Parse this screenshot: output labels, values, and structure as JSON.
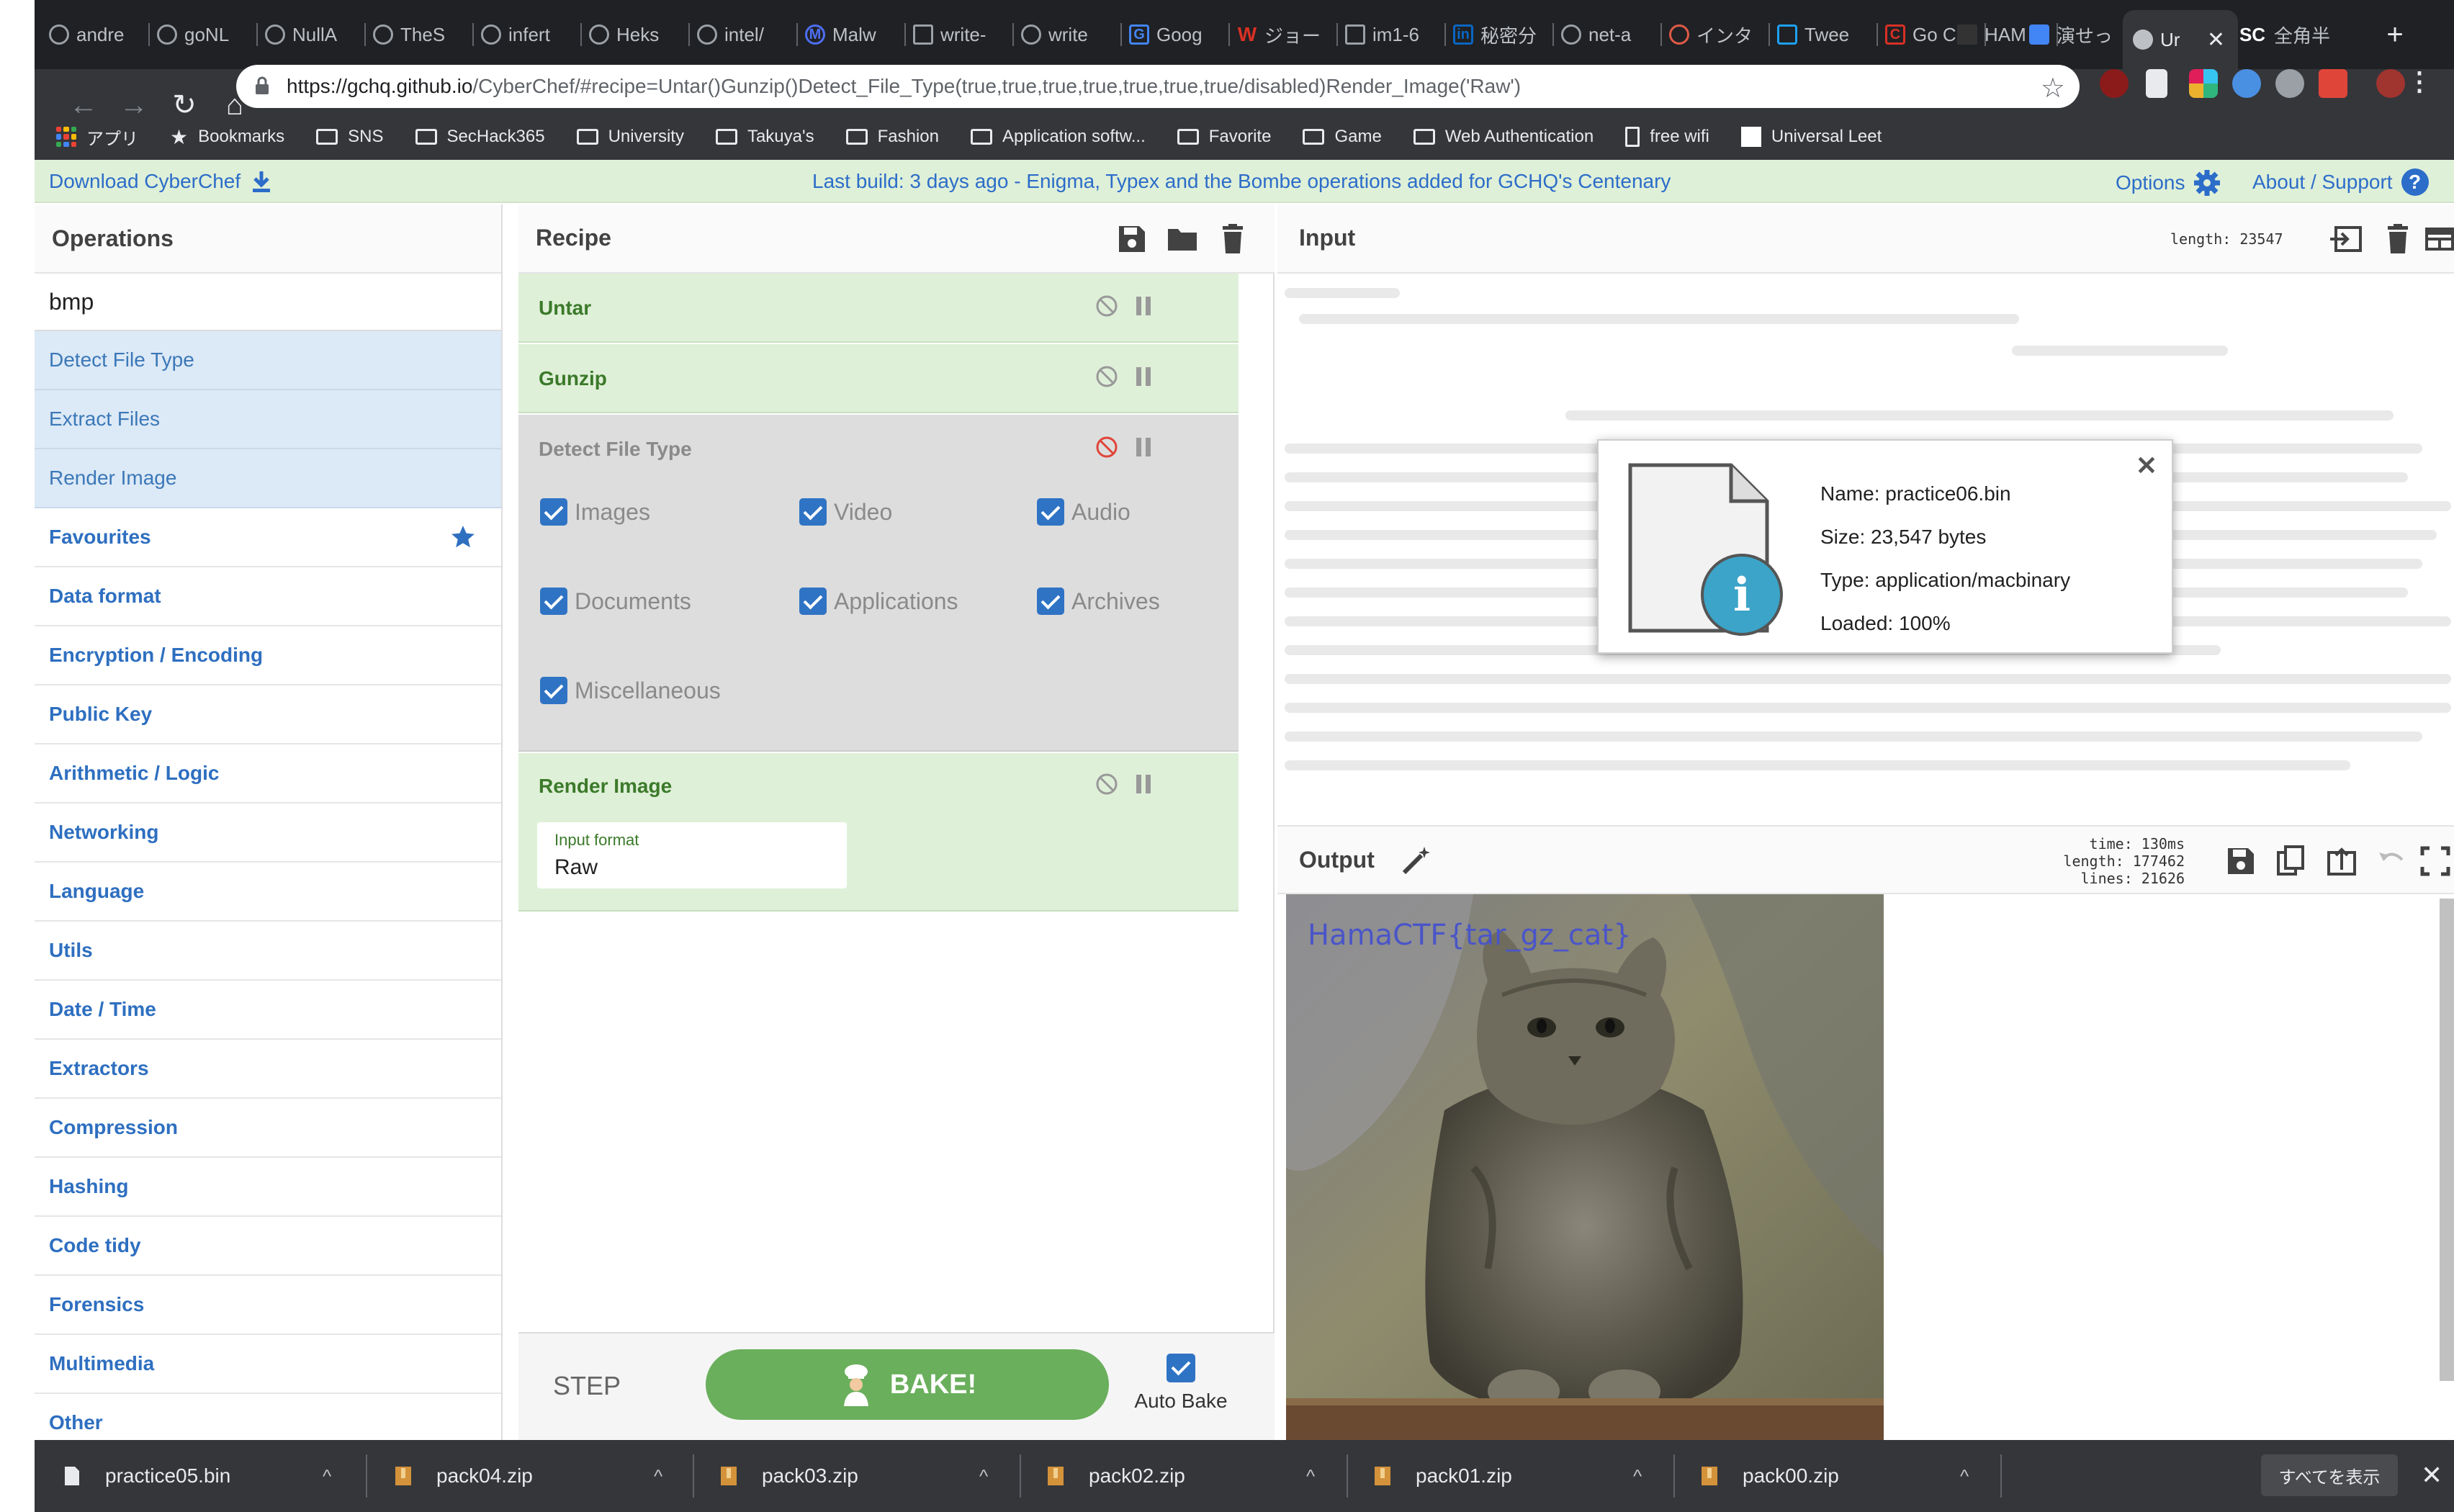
{
  "browser": {
    "tabs": [
      {
        "label": "andre"
      },
      {
        "label": "goNL"
      },
      {
        "label": "NullA"
      },
      {
        "label": "TheS"
      },
      {
        "label": "infert"
      },
      {
        "label": "Heks"
      },
      {
        "label": "intel/"
      },
      {
        "label": "Malw"
      },
      {
        "label": "write-"
      },
      {
        "label": "write"
      },
      {
        "label": "Goog"
      },
      {
        "label": "ジョー"
      },
      {
        "label": "im1-6"
      },
      {
        "label": "秘密分"
      },
      {
        "label": "net-a"
      },
      {
        "label": "インタ"
      },
      {
        "label": "Twee"
      },
      {
        "label": "Go C"
      },
      {
        "label": "HAM"
      },
      {
        "label": "演せっ"
      },
      {
        "label": "Ur"
      },
      {
        "label": "全角半"
      }
    ],
    "url": {
      "host": "https://gchq.github.io",
      "rest": "/CyberChef/#recipe=Untar()Gunzip()Detect_File_Type(true,true,true,true,true,true,true/disabled)Render_Image('Raw')"
    },
    "bookmarks": [
      "アプリ",
      "Bookmarks",
      "SNS",
      "SecHack365",
      "University",
      "Takuya's",
      "Fashion",
      "Application softw...",
      "Favorite",
      "Game",
      "Web Authentication",
      "free wifi",
      "Universal Leet"
    ]
  },
  "banner": {
    "download": "Download CyberChef",
    "build": "Last build: 3 days ago - Enigma, Typex and the Bombe operations added for GCHQ's Centenary",
    "options": "Options",
    "about": "About / Support"
  },
  "operations": {
    "title": "Operations",
    "search": "bmp",
    "results": [
      "Detect File Type",
      "Extract Files",
      "Render Image"
    ],
    "categories": [
      "Favourites",
      "Data format",
      "Encryption / Encoding",
      "Public Key",
      "Arithmetic / Logic",
      "Networking",
      "Language",
      "Utils",
      "Date / Time",
      "Extractors",
      "Compression",
      "Hashing",
      "Code tidy",
      "Forensics",
      "Multimedia",
      "Other"
    ]
  },
  "recipe": {
    "title": "Recipe",
    "ops": [
      "Untar",
      "Gunzip",
      "Detect File Type",
      "Render Image"
    ],
    "checkboxes": [
      "Images",
      "Video",
      "Audio",
      "Documents",
      "Applications",
      "Archives",
      "Miscellaneous"
    ],
    "input_format_label": "Input format",
    "input_format_value": "Raw",
    "step": "STEP",
    "bake": "BAKE!",
    "autobake": "Auto Bake"
  },
  "input": {
    "title": "Input",
    "length": "length: 23547"
  },
  "fileinfo": {
    "name": "Name: practice06.bin",
    "size": "Size: 23,547 bytes",
    "type": "Type: application/macbinary",
    "loaded": "Loaded: 100%"
  },
  "output": {
    "title": "Output",
    "time": "time:  130ms",
    "length": "length: 177462",
    "lines": "lines:  21626",
    "flag": "HamaCTF{tar_gz_cat}"
  },
  "downloads": {
    "items": [
      "practice05.bin",
      "pack04.zip",
      "pack03.zip",
      "pack02.zip",
      "pack01.zip",
      "pack00.zip"
    ],
    "show_all": "すべてを表示"
  },
  "colors": {
    "chrome_dark": "#202124",
    "chrome_toolbar": "#35363a",
    "banner_bg": "#dff0d8",
    "link_blue": "#2c6dc9",
    "recipe_green": "#dff0d8",
    "bake_green": "#6aaf5c",
    "disabled_red": "#e0453a"
  }
}
